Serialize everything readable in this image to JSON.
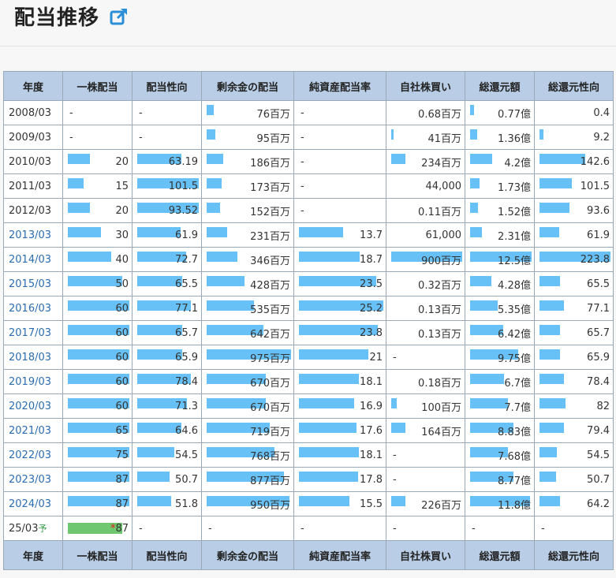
{
  "title": "配当推移",
  "headers": [
    "年度",
    "一株配当",
    "配当性向",
    "剰余金の配当",
    "純資産配当率",
    "自社株買い",
    "総還元額",
    "総還元性向"
  ],
  "rows": [
    {
      "year": "2008/03",
      "link": false,
      "dps": "-",
      "payout": "-",
      "div": "76百万",
      "nar": "-",
      "buyback": "0.68百万",
      "total": "0.77億",
      "tpr": "0.4"
    },
    {
      "year": "2009/03",
      "link": false,
      "dps": "-",
      "payout": "-",
      "div": "95百万",
      "nar": "-",
      "buyback": "41百万",
      "total": "1.36億",
      "tpr": "9.2"
    },
    {
      "year": "2010/03",
      "link": false,
      "dps": "20",
      "payout": "63.19",
      "div": "186百万",
      "nar": "-",
      "buyback": "234百万",
      "total": "4.2億",
      "tpr": "142.6"
    },
    {
      "year": "2011/03",
      "link": false,
      "dps": "15",
      "payout": "101.5",
      "div": "173百万",
      "nar": "-",
      "buyback": "44,000",
      "total": "1.73億",
      "tpr": "101.5"
    },
    {
      "year": "2012/03",
      "link": false,
      "dps": "20",
      "payout": "93.52",
      "div": "152百万",
      "nar": "-",
      "buyback": "0.11百万",
      "total": "1.52億",
      "tpr": "93.6"
    },
    {
      "year": "2013/03",
      "link": true,
      "dps": "30",
      "payout": "61.9",
      "div": "231百万",
      "nar": "13.7",
      "buyback": "61,000",
      "total": "2.31億",
      "tpr": "61.9"
    },
    {
      "year": "2014/03",
      "link": true,
      "dps": "40",
      "payout": "72.7",
      "div": "346百万",
      "nar": "18.7",
      "buyback": "900百万",
      "total": "12.5億",
      "tpr": "223.8"
    },
    {
      "year": "2015/03",
      "link": true,
      "dps": "50",
      "payout": "65.5",
      "div": "428百万",
      "nar": "23.5",
      "buyback": "0.32百万",
      "total": "4.28億",
      "tpr": "65.5"
    },
    {
      "year": "2016/03",
      "link": true,
      "dps": "60",
      "payout": "77.1",
      "div": "535百万",
      "nar": "25.2",
      "buyback": "0.13百万",
      "total": "5.35億",
      "tpr": "77.1"
    },
    {
      "year": "2017/03",
      "link": true,
      "dps": "60",
      "payout": "65.7",
      "div": "642百万",
      "nar": "23.8",
      "buyback": "0.13百万",
      "total": "6.42億",
      "tpr": "65.7"
    },
    {
      "year": "2018/03",
      "link": true,
      "dps": "60",
      "payout": "65.9",
      "div": "975百万",
      "nar": "21",
      "buyback": "-",
      "total": "9.75億",
      "tpr": "65.9"
    },
    {
      "year": "2019/03",
      "link": true,
      "dps": "60",
      "payout": "78.4",
      "div": "670百万",
      "nar": "18.1",
      "buyback": "0.18百万",
      "total": "6.7億",
      "tpr": "78.4"
    },
    {
      "year": "2020/03",
      "link": true,
      "dps": "60",
      "payout": "71.3",
      "div": "670百万",
      "nar": "16.9",
      "buyback": "100百万",
      "total": "7.7億",
      "tpr": "82"
    },
    {
      "year": "2021/03",
      "link": true,
      "dps": "65",
      "payout": "64.6",
      "div": "719百万",
      "nar": "17.6",
      "buyback": "164百万",
      "total": "8.83億",
      "tpr": "79.4"
    },
    {
      "year": "2022/03",
      "link": true,
      "dps": "75",
      "payout": "54.5",
      "div": "768百万",
      "nar": "18.1",
      "buyback": "-",
      "total": "7.68億",
      "tpr": "54.5"
    },
    {
      "year": "2023/03",
      "link": true,
      "dps": "87",
      "payout": "50.7",
      "div": "877百万",
      "nar": "17.8",
      "buyback": "-",
      "total": "8.77億",
      "tpr": "50.7"
    },
    {
      "year": "2024/03",
      "link": true,
      "dps": "87",
      "payout": "51.8",
      "div": "950百万",
      "nar": "15.5",
      "buyback": "226百万",
      "total": "11.8億",
      "tpr": "64.2"
    }
  ],
  "forecast": {
    "year": "25/03",
    "yo_mark": "予",
    "star": "*",
    "dps": "87",
    "payout": "-",
    "div": "-",
    "nar": "-",
    "buyback": "-",
    "total": "-",
    "tpr": "-"
  },
  "bar_levels": {
    "dps": [
      0,
      0,
      0.36,
      0.25,
      0.36,
      0.54,
      0.71,
      0.89,
      1,
      1,
      1,
      1,
      1,
      1,
      1,
      1,
      1
    ],
    "payout": [
      0,
      0,
      0.72,
      1,
      1,
      0.71,
      0.8,
      0.73,
      0.87,
      0.73,
      0.73,
      0.87,
      0.81,
      0.72,
      0.6,
      0.53,
      0.55
    ],
    "div": [
      0.08,
      0.1,
      0.2,
      0.18,
      0.16,
      0.24,
      0.36,
      0.45,
      0.56,
      0.67,
      1,
      0.7,
      0.7,
      0.75,
      0.8,
      0.92,
      0.98
    ],
    "nar": [
      0,
      0,
      0,
      0,
      0,
      0.52,
      0.72,
      0.92,
      1,
      0.93,
      0.82,
      0.71,
      0.65,
      0.68,
      0.71,
      0.7,
      0.6
    ],
    "buyback": [
      0,
      0.03,
      0.2,
      0,
      0,
      0,
      1,
      0,
      0,
      0,
      0,
      0,
      0.08,
      0.2,
      0,
      0,
      0.2
    ],
    "total": [
      0.07,
      0.11,
      0.36,
      0.15,
      0.13,
      0.19,
      1,
      0.35,
      0.45,
      0.54,
      0.78,
      0.55,
      0.61,
      0.71,
      0.61,
      0.71,
      0.98
    ],
    "tpr": [
      0,
      0.05,
      0.64,
      0.45,
      0.42,
      0.28,
      1,
      0.29,
      0.35,
      0.29,
      0.29,
      0.35,
      0.37,
      0.35,
      0.24,
      0.23,
      0.29
    ],
    "forecast_dps": 0.88
  },
  "colors": {
    "bar": "#67c1f6",
    "bar_forecast": "#6fc86f",
    "header_bg": "#b9cee6",
    "link": "#2a6db0"
  }
}
